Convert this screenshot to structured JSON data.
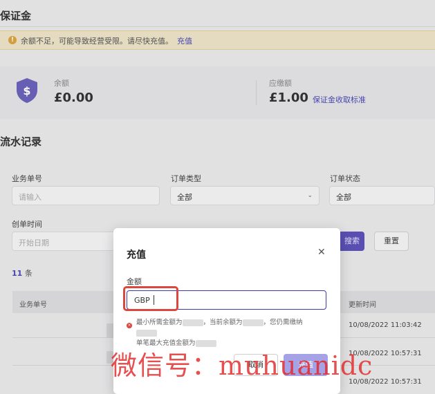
{
  "page": {
    "title": "保证金",
    "notice": {
      "text": "余额不足，可能导致经营受限。请尽快充值。",
      "link": "充值"
    },
    "balance": {
      "label": "余额",
      "value": "£0.00"
    },
    "due": {
      "label": "应缴额",
      "value": "£1.00",
      "link": "保证金收取标准"
    }
  },
  "records": {
    "title": "流水记录",
    "filters": {
      "order_no": {
        "label": "业务单号",
        "placeholder": "请输入"
      },
      "order_type": {
        "label": "订单类型",
        "value": "全部"
      },
      "order_status": {
        "label": "订单状态",
        "value": "全部"
      },
      "created_time": {
        "label": "创单时间",
        "placeholder": "开始日期"
      },
      "search_label": "搜索",
      "reset_label": "重置"
    },
    "count": {
      "number": "11",
      "unit": "条"
    },
    "table": {
      "columns": [
        "业务单号",
        "更新时间"
      ],
      "rows": [
        {
          "update_time": "10/08/2022 11:03:42"
        },
        {
          "update_time": "10/08/2022 10:57:31"
        },
        {
          "update_time": "10/08/2022 10:57:31"
        }
      ]
    }
  },
  "modal": {
    "title": "充值",
    "close_icon": "close-icon",
    "amount_label": "金额",
    "currency": "GBP",
    "hint_part1": "最小所需金额为",
    "hint_part2": "，当前余额为",
    "hint_part3": "，您仍需缴纳",
    "hint_part4": "单笔最大充值金额为",
    "cancel_label": "取消",
    "confirm_label": "充值"
  },
  "watermark": "微信号：muhuanidc",
  "colors": {
    "accent": "#4a49b5",
    "highlight": "#d9473d",
    "watermark": "#e02828"
  }
}
